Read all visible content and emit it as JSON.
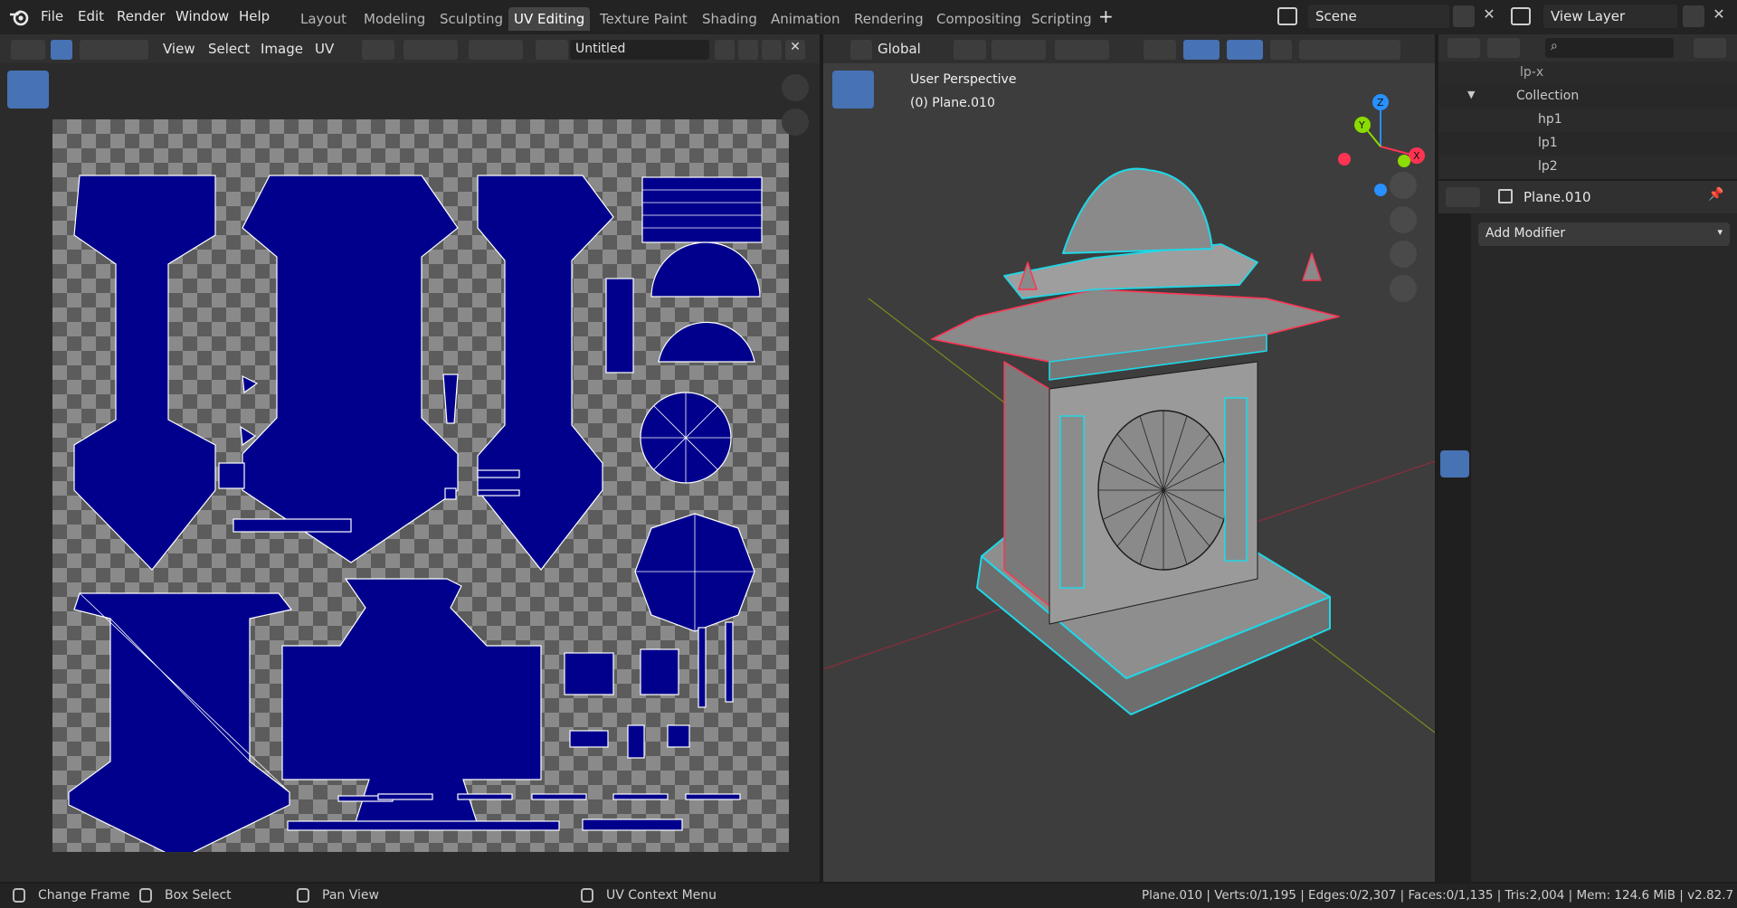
{
  "app": {
    "menus": [
      "File",
      "Edit",
      "Render",
      "Window",
      "Help"
    ],
    "workspaces": [
      "Layout",
      "Modeling",
      "Sculpting",
      "UV Editing",
      "Texture Paint",
      "Shading",
      "Animation",
      "Rendering",
      "Compositing",
      "Scripting"
    ],
    "active_workspace": "UV Editing",
    "scene_label": "Scene",
    "view_layer_label": "View Layer"
  },
  "uv_editor": {
    "menus": [
      "View",
      "Select",
      "Image",
      "UV"
    ],
    "image_name": "Untitled"
  },
  "viewport": {
    "orientation": "Global",
    "overlay_title": "User Perspective",
    "overlay_object": "(0) Plane.010",
    "gizmo_labels": {
      "x": "X",
      "y": "Y",
      "z": "Z"
    }
  },
  "outliner": {
    "search_placeholder": "",
    "items": [
      {
        "name": "lp-x",
        "level": 2
      },
      {
        "name": "Collection",
        "level": 1
      },
      {
        "name": "hp1",
        "level": 2
      },
      {
        "name": "lp1",
        "level": 2
      },
      {
        "name": "lp2",
        "level": 2
      }
    ]
  },
  "properties": {
    "object_name": "Plane.010",
    "add_modifier_label": "Add Modifier"
  },
  "statusbar": {
    "change_frame": "Change Frame",
    "box_select": "Box Select",
    "pan_view": "Pan View",
    "uv_context_menu": "UV Context Menu",
    "stats": "Plane.010 | Verts:0/1,195 | Edges:0/2,307 | Faces:0/1,135 | Tris:2,004 | Mem: 124.6 MiB | v2.82.7"
  },
  "colors": {
    "accent_blue": "#4772b3",
    "uv_island_fill": "#00008c",
    "checker_light": "#8a8a8a",
    "checker_dark": "#5c5c5c",
    "viewport_bg": "#3d3d3d",
    "selection_cyan": "#1ed8e8",
    "axis_x": "#ff3352",
    "axis_y": "#8bdc00",
    "axis_z": "#2890ff"
  }
}
